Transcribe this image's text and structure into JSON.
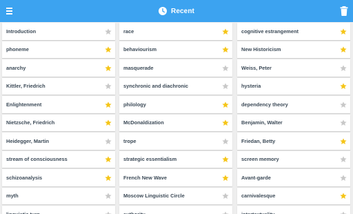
{
  "header": {
    "title": "Recent",
    "menu_icon": "menu-icon",
    "clock_icon": "clock-icon",
    "trash_icon": "trash-icon"
  },
  "colors": {
    "appbar": "#3ca3f0",
    "star_on": "#f5c518",
    "star_off": "#c8c8c8",
    "text": "#3c4a57"
  },
  "columns": [
    [
      {
        "label": "Introduction",
        "starred": false
      },
      {
        "label": "phoneme",
        "starred": true
      },
      {
        "label": "anarchy",
        "starred": true
      },
      {
        "label": "Kittler, Friedrich",
        "starred": false
      },
      {
        "label": "Enlightenment",
        "starred": true
      },
      {
        "label": "Nietzsche, Friedrich",
        "starred": true
      },
      {
        "label": "Heidegger, Martin",
        "starred": false
      },
      {
        "label": "stream of consciousness",
        "starred": true
      },
      {
        "label": "schizoanalysis",
        "starred": true
      },
      {
        "label": "myth",
        "starred": false
      },
      {
        "label": "linguistic turn",
        "starred": false
      }
    ],
    [
      {
        "label": "race",
        "starred": true
      },
      {
        "label": "behaviourism",
        "starred": true
      },
      {
        "label": "masquerade",
        "starred": false
      },
      {
        "label": "synchronic and diachronic",
        "starred": false
      },
      {
        "label": "philology",
        "starred": true
      },
      {
        "label": "McDonaldization",
        "starred": true
      },
      {
        "label": "trope",
        "starred": false
      },
      {
        "label": "strategic essentialism",
        "starred": true
      },
      {
        "label": "French New Wave",
        "starred": true
      },
      {
        "label": "Moscow Linguistic Circle",
        "starred": false
      },
      {
        "label": "authority",
        "starred": false
      }
    ],
    [
      {
        "label": "cognitive estrangement",
        "starred": true
      },
      {
        "label": "New Historicism",
        "starred": true
      },
      {
        "label": "Weiss, Peter",
        "starred": false
      },
      {
        "label": "hysteria",
        "starred": true
      },
      {
        "label": "dependency theory",
        "starred": false
      },
      {
        "label": "Benjamin, Walter",
        "starred": false
      },
      {
        "label": "Friedan, Betty",
        "starred": true
      },
      {
        "label": "screen memory",
        "starred": false
      },
      {
        "label": "Avant-garde",
        "starred": false
      },
      {
        "label": "carnivalesque",
        "starred": true
      },
      {
        "label": "intertextuality",
        "starred": false
      }
    ]
  ]
}
